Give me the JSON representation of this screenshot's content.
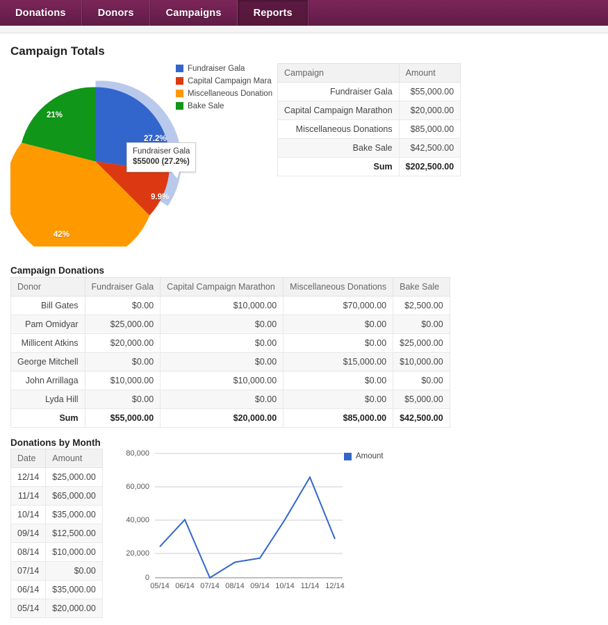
{
  "nav": {
    "tabs": [
      {
        "label": "Donations",
        "active": false
      },
      {
        "label": "Donors",
        "active": false
      },
      {
        "label": "Campaigns",
        "active": false
      },
      {
        "label": "Reports",
        "active": true
      }
    ]
  },
  "sections": {
    "campaign_totals_title": "Campaign Totals",
    "campaign_donations_title": "Campaign Donations",
    "donations_by_month_title": "Donations by Month"
  },
  "campaign_totals_table": {
    "headers": [
      "Campaign",
      "Amount"
    ],
    "rows": [
      {
        "campaign": "Fundraiser Gala",
        "amount": "$55,000.00"
      },
      {
        "campaign": "Capital Campaign Marathon",
        "amount": "$20,000.00"
      },
      {
        "campaign": "Miscellaneous Donations",
        "amount": "$85,000.00"
      },
      {
        "campaign": "Bake Sale",
        "amount": "$42,500.00"
      }
    ],
    "sum": {
      "label": "Sum",
      "amount": "$202,500.00"
    }
  },
  "campaign_donations_table": {
    "headers": [
      "Donor",
      "Fundraiser Gala",
      "Capital Campaign Marathon",
      "Miscellaneous Donations",
      "Bake Sale"
    ],
    "rows": [
      {
        "donor": "Bill Gates",
        "gala": "$0.00",
        "capital": "$10,000.00",
        "misc": "$70,000.00",
        "bake": "$2,500.00"
      },
      {
        "donor": "Pam Omidyar",
        "gala": "$25,000.00",
        "capital": "$0.00",
        "misc": "$0.00",
        "bake": "$0.00"
      },
      {
        "donor": "Millicent Atkins",
        "gala": "$20,000.00",
        "capital": "$0.00",
        "misc": "$0.00",
        "bake": "$25,000.00"
      },
      {
        "donor": "George Mitchell",
        "gala": "$0.00",
        "capital": "$0.00",
        "misc": "$15,000.00",
        "bake": "$10,000.00"
      },
      {
        "donor": "John Arrillaga",
        "gala": "$10,000.00",
        "capital": "$10,000.00",
        "misc": "$0.00",
        "bake": "$0.00"
      },
      {
        "donor": "Lyda Hill",
        "gala": "$0.00",
        "capital": "$0.00",
        "misc": "$0.00",
        "bake": "$5,000.00"
      }
    ],
    "sum": {
      "label": "Sum",
      "gala": "$55,000.00",
      "capital": "$20,000.00",
      "misc": "$85,000.00",
      "bake": "$42,500.00"
    }
  },
  "donations_by_month_table": {
    "headers": [
      "Date",
      "Amount"
    ],
    "rows": [
      {
        "date": "12/14",
        "amount": "$25,000.00"
      },
      {
        "date": "11/14",
        "amount": "$65,000.00"
      },
      {
        "date": "10/14",
        "amount": "$35,000.00"
      },
      {
        "date": "09/14",
        "amount": "$12,500.00"
      },
      {
        "date": "08/14",
        "amount": "$10,000.00"
      },
      {
        "date": "07/14",
        "amount": "$0.00"
      },
      {
        "date": "06/14",
        "amount": "$35,000.00"
      },
      {
        "date": "05/14",
        "amount": "$20,000.00"
      }
    ]
  },
  "pie_tooltip": {
    "title": "Fundraiser Gala",
    "value": "$55000 (27.2%)"
  },
  "chart_data": [
    {
      "type": "pie",
      "title": "Campaign Totals",
      "legend_position": "right",
      "legend_clipped": true,
      "highlighted_slice": "Fundraiser Gala",
      "categories": [
        "Fundraiser Gala",
        "Capital Campaign Marathon",
        "Miscellaneous Donations",
        "Bake Sale"
      ],
      "legend_labels": [
        "Fundraiser Gala",
        "Capital Campaign Mara",
        "Miscellaneous Donation",
        "Bake Sale"
      ],
      "values": [
        55000,
        20000,
        85000,
        42500
      ],
      "percent_labels": [
        "27.2%",
        "9.9%",
        "42%",
        "21%"
      ],
      "colors": [
        "#3366cc",
        "#dc3912",
        "#ff9900",
        "#109618"
      ],
      "total": 202500
    },
    {
      "type": "line",
      "title": "Donations by Month",
      "x": [
        "05/14",
        "06/14",
        "07/14",
        "08/14",
        "09/14",
        "10/14",
        "11/14",
        "12/14"
      ],
      "series": [
        {
          "name": "Amount",
          "values": [
            20000,
            35000,
            0,
            10000,
            12500,
            35000,
            65000,
            25000
          ],
          "color": "#3366cc"
        }
      ],
      "ylabel": "",
      "xlabel": "",
      "ylim": [
        0,
        80000
      ],
      "y_ticks": [
        "0",
        "20,000",
        "40,000",
        "60,000",
        "80,000"
      ],
      "grid": true,
      "legend_position": "right",
      "legend_entries": [
        "Amount"
      ]
    }
  ],
  "colors": {
    "nav_background": "#6d2050",
    "nav_active": "#5d1a43",
    "pie_blue": "#3366cc",
    "pie_red": "#dc3912",
    "pie_orange": "#ff9900",
    "pie_green": "#109618",
    "pie_highlight": "#b9c9ec",
    "line_blue": "#3366cc"
  }
}
